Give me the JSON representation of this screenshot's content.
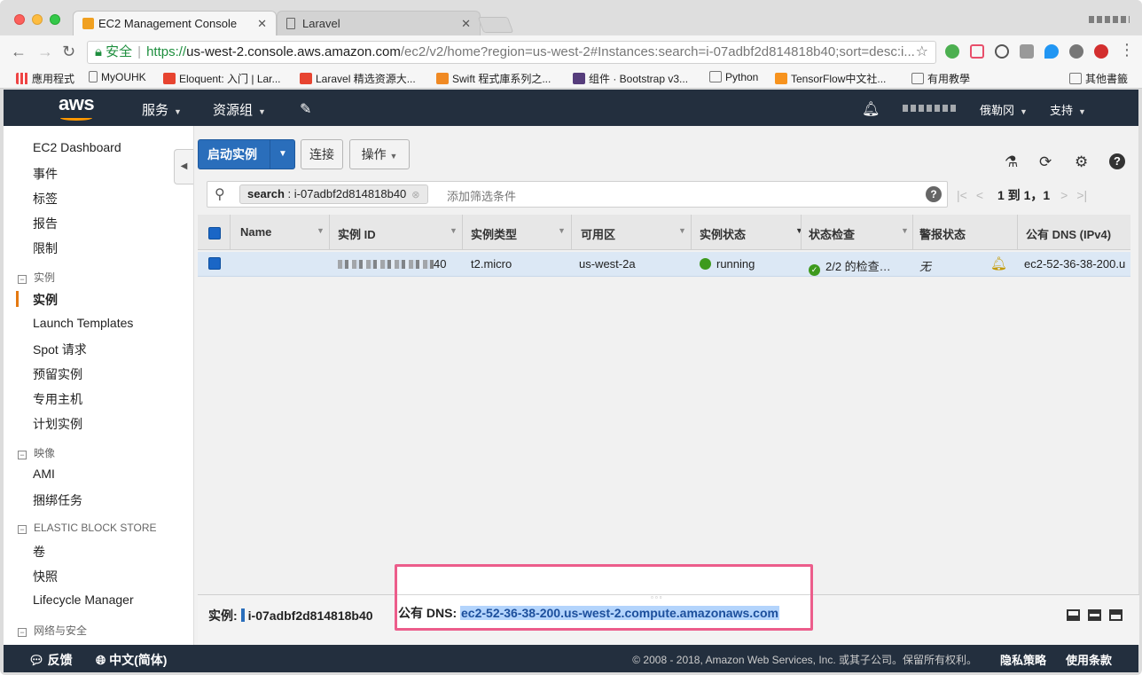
{
  "browser": {
    "tabs": [
      {
        "title": "EC2 Management Console",
        "active": true
      },
      {
        "title": "Laravel",
        "active": false
      }
    ],
    "url": {
      "security_label": "安全",
      "scheme": "https://",
      "host": "us-west-2.console.aws.amazon.com",
      "path": "/ec2/v2/home?region=us-west-2#Instances:search=i-07adbf2d814818b40;sort=desc:i..."
    },
    "bookmarks": [
      {
        "label": "應用程式",
        "icon": "apps-grid-icon"
      },
      {
        "label": "MyOUHK",
        "icon": "page-icon"
      },
      {
        "label": "Eloquent: 入门 | Lar...",
        "icon": "laravel-icon"
      },
      {
        "label": "Laravel 精选资源大...",
        "icon": "laravel-icon"
      },
      {
        "label": "Swift 程式庫系列之...",
        "icon": "swift-icon"
      },
      {
        "label": "组件 · Bootstrap v3...",
        "icon": "bootstrap-icon"
      },
      {
        "label": "Python",
        "icon": "folder-icon"
      },
      {
        "label": "TensorFlow中文社...",
        "icon": "tensorflow-icon"
      },
      {
        "label": "有用教學",
        "icon": "folder-icon"
      },
      {
        "label": "其他書籤",
        "icon": "folder-icon"
      }
    ]
  },
  "aws_header": {
    "logo": "aws",
    "services": "服务",
    "resource_groups": "资源组",
    "region": "俄勒冈",
    "support": "支持"
  },
  "sidebar": {
    "top_items": [
      "EC2 Dashboard",
      "事件",
      "标签",
      "报告",
      "限制"
    ],
    "sections": [
      {
        "title": "实例",
        "items": [
          "实例",
          "Launch Templates",
          "Spot 请求",
          "预留实例",
          "专用主机",
          "计划实例"
        ]
      },
      {
        "title": "映像",
        "items": [
          "AMI",
          "捆绑任务"
        ]
      },
      {
        "title": "ELASTIC BLOCK STORE",
        "items": [
          "卷",
          "快照",
          "Lifecycle Manager"
        ]
      },
      {
        "title": "网络与安全",
        "items": []
      }
    ],
    "active_item": "实例"
  },
  "actions": {
    "launch": "启动实例",
    "connect": "连接",
    "actions": "操作"
  },
  "search": {
    "token_key": "search",
    "token_value": "i-07adbf2d814818b40",
    "placeholder": "添加筛选条件"
  },
  "pager": {
    "text": "1 到 1，1"
  },
  "table": {
    "columns": [
      "Name",
      "实例 ID",
      "实例类型",
      "可用区",
      "实例状态",
      "状态检查",
      "警报状态",
      "公有 DNS (IPv4)"
    ],
    "rows": [
      {
        "name": "",
        "instance_id_suffix": "40",
        "instance_type": "t2.micro",
        "zone": "us-west-2a",
        "state": "running",
        "status_check": "2/2 的检查…",
        "alarm": "无",
        "public_dns": "ec2-52-36-38-200.u"
      }
    ]
  },
  "detail": {
    "instance_label": "实例:",
    "instance_id": "i-07adbf2d814818b40",
    "dns_label": "公有 DNS:",
    "dns_value": "ec2-52-36-38-200.us-west-2.compute.amazonaws.com"
  },
  "footer": {
    "feedback": "反馈",
    "language": "中文(简体)",
    "copyright": "© 2008 - 2018, Amazon Web Services, Inc. 或其子公司。保留所有权利。",
    "privacy": "隐私策略",
    "terms": "使用条款"
  },
  "colors": {
    "aws_header": "#232f3e",
    "aws_orange": "#ff9900",
    "primary_button": "#2a6ebb",
    "highlight_border": "#ec5d8b",
    "running_green": "#3d9a1d"
  }
}
